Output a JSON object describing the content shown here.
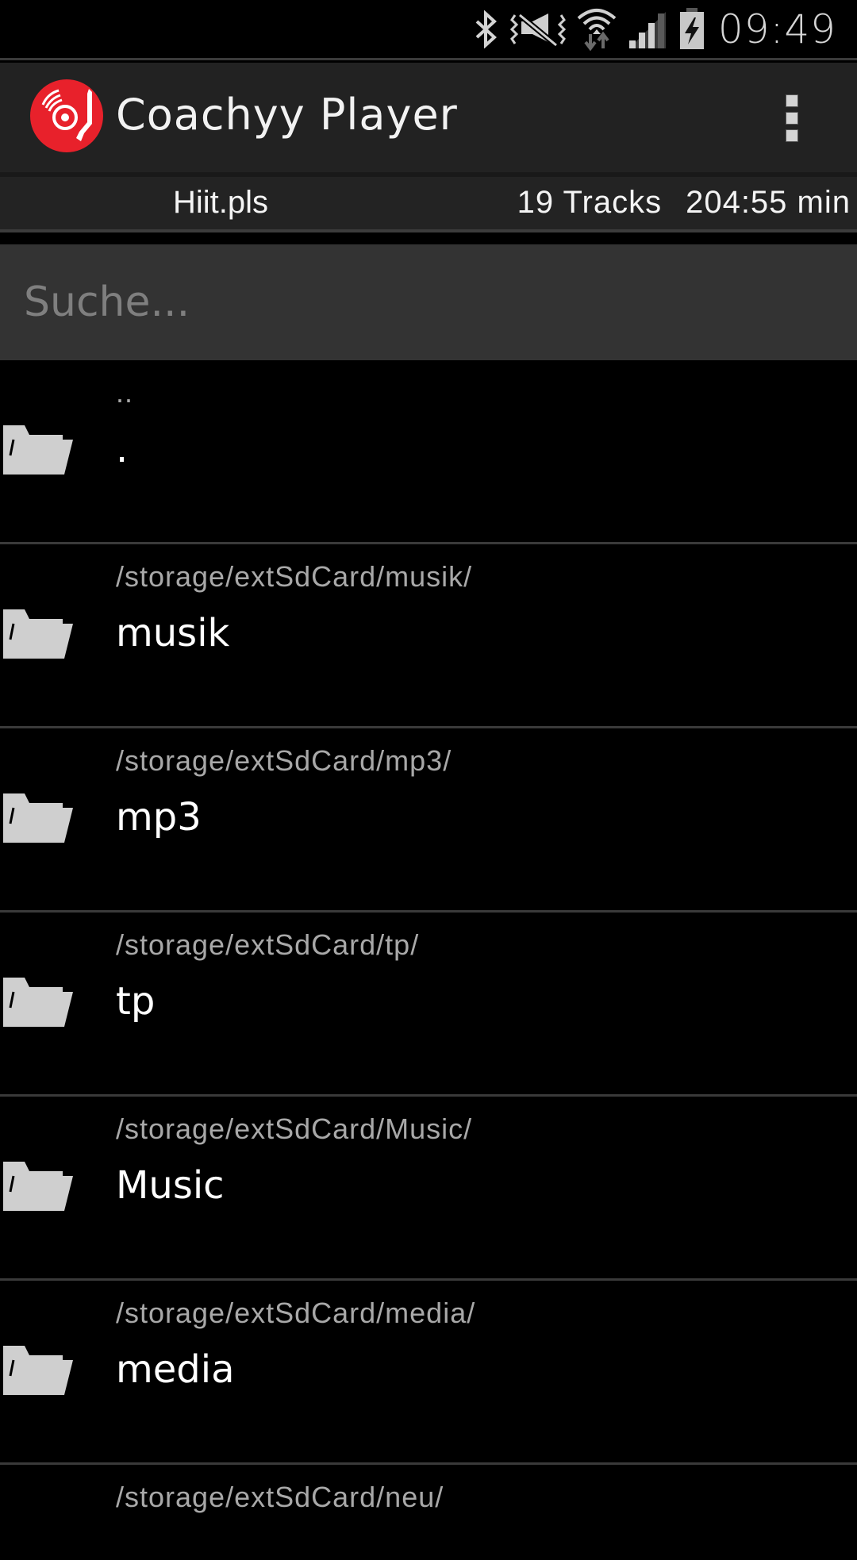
{
  "status_bar": {
    "time": "09:49",
    "icons": [
      "bluetooth-icon",
      "vibrate-mute-icon",
      "wifi-data-icon",
      "signal-icon",
      "battery-charging-icon"
    ]
  },
  "action_bar": {
    "title": "Coachyy Player",
    "logo": "record-turntable-logo",
    "overflow_icon": "more-vert-icon",
    "brand_color": "#e8212b"
  },
  "playlist_info": {
    "name": "Hiit.pls",
    "tracks": "19 Tracks",
    "duration": "204:55 min"
  },
  "search": {
    "placeholder": "Suche...",
    "value": ""
  },
  "files": [
    {
      "path": "..",
      "name": ".",
      "icon": "folder-icon"
    },
    {
      "path": "/storage/extSdCard/musik/",
      "name": "musik",
      "icon": "folder-icon"
    },
    {
      "path": "/storage/extSdCard/mp3/",
      "name": "mp3",
      "icon": "folder-icon"
    },
    {
      "path": "/storage/extSdCard/tp/",
      "name": "tp",
      "icon": "folder-icon"
    },
    {
      "path": "/storage/extSdCard/Music/",
      "name": "Music",
      "icon": "folder-icon"
    },
    {
      "path": "/storage/extSdCard/media/",
      "name": "media",
      "icon": "folder-icon"
    },
    {
      "path": "/storage/extSdCard/neu/",
      "name": "",
      "icon": "folder-icon"
    }
  ]
}
